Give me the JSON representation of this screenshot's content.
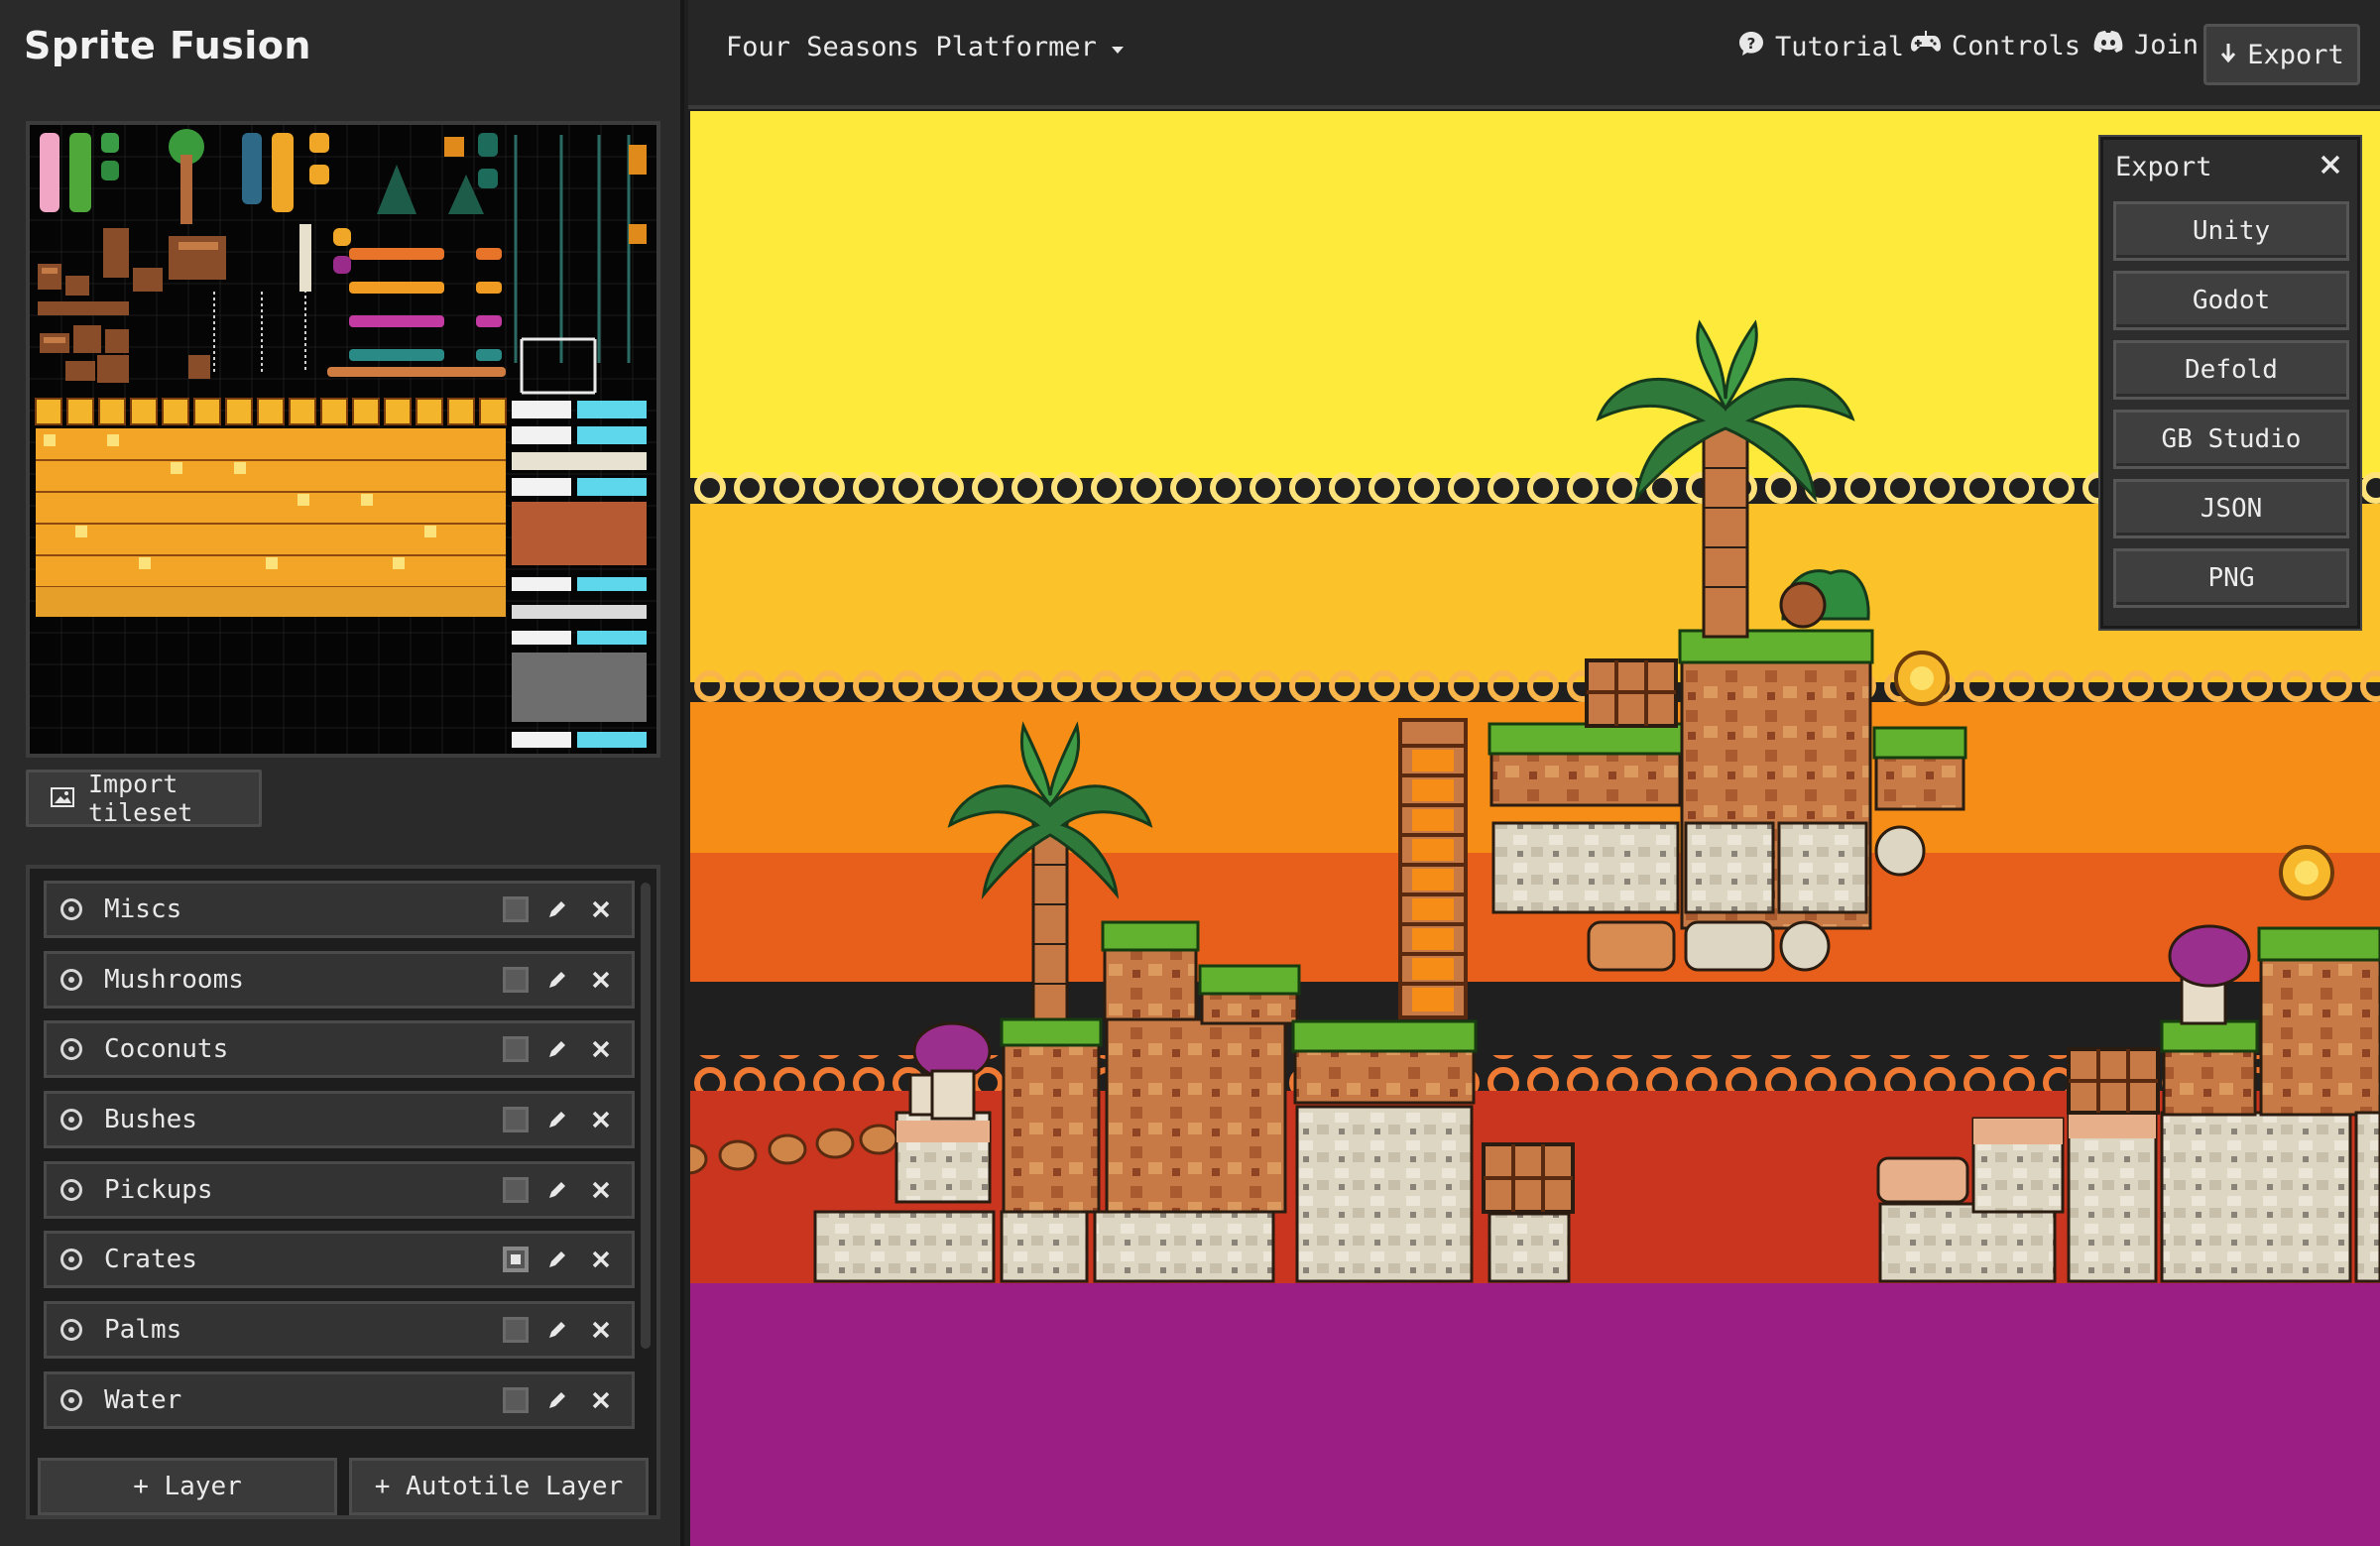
{
  "app": {
    "title": "Sprite Fusion"
  },
  "sidebar": {
    "import_label": "Import tileset",
    "layers": [
      {
        "name": "Miscs",
        "selected": false
      },
      {
        "name": "Mushrooms",
        "selected": false
      },
      {
        "name": "Coconuts",
        "selected": false
      },
      {
        "name": "Bushes",
        "selected": false
      },
      {
        "name": "Pickups",
        "selected": false
      },
      {
        "name": "Crates",
        "selected": true
      },
      {
        "name": "Palms",
        "selected": false
      },
      {
        "name": "Water",
        "selected": false
      }
    ],
    "add_layer_label": "+ Layer",
    "add_autotile_label": "+ Autotile Layer"
  },
  "topbar": {
    "project_name": "Four Seasons Platformer",
    "tutorial_label": "Tutorial",
    "controls_label": "Controls",
    "join_label": "Join",
    "export_label": "Export"
  },
  "export_panel": {
    "title": "Export",
    "options": [
      "Unity",
      "Godot",
      "Defold",
      "GB Studio",
      "JSON",
      "PNG"
    ]
  },
  "colors": {
    "sky_top": "#fde93c",
    "sky_mid": "#fbc12a",
    "sky_orange": "#f28b17",
    "sky_deep": "#e65d1b",
    "sky_red": "#c7341d",
    "water": "#9a1e84",
    "grass": "#5fb12f",
    "dirt": "#c67a42",
    "stone": "#d9d2bf"
  }
}
